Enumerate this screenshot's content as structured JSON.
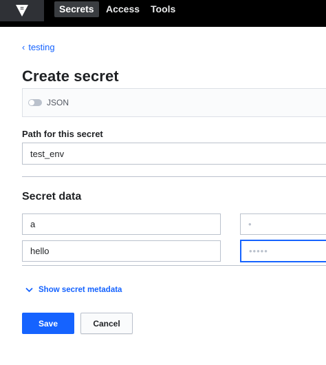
{
  "header": {
    "logo_icon": "vault-logo-icon",
    "nav": [
      {
        "label": "Secrets",
        "active": true
      },
      {
        "label": "Access",
        "active": false
      },
      {
        "label": "Tools",
        "active": false
      }
    ]
  },
  "breadcrumb": {
    "label": "testing",
    "icon": "chevron-left-icon"
  },
  "page": {
    "title": "Create secret"
  },
  "json_toggle": {
    "label": "JSON",
    "enabled": false
  },
  "path": {
    "label": "Path for this secret",
    "value": "test_env"
  },
  "secret_data": {
    "title": "Secret data",
    "rows": [
      {
        "key": "a",
        "value_mask": "•"
      },
      {
        "key": "hello",
        "value_mask": "•••••"
      }
    ]
  },
  "metadata": {
    "label": "Show secret metadata",
    "icon": "chevron-down-icon"
  },
  "actions": {
    "save_label": "Save",
    "cancel_label": "Cancel"
  },
  "colors": {
    "accent": "#1563ff",
    "topbar": "#000000",
    "border": "#bac1cc"
  }
}
